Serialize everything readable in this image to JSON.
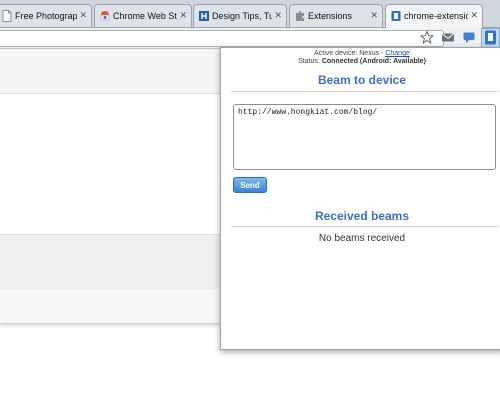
{
  "tabs": [
    {
      "title": "Free Photograph",
      "icon": "page-icon"
    },
    {
      "title": "Chrome Web Sto",
      "icon": "chrome-webstore-icon"
    },
    {
      "title": "Design Tips, Tut",
      "icon": "hongkiat-h-icon"
    },
    {
      "title": "Extensions",
      "icon": "puzzle-icon"
    },
    {
      "title": "chrome-extensio",
      "icon": "extension-page-icon"
    }
  ],
  "toolbar": {
    "icons": [
      "star-icon",
      "gmail-icon",
      "chat-bubble-icon",
      "chrome-to-phone-icon"
    ]
  },
  "popup": {
    "device_label": "Active device: Nexus - ",
    "change_link": "Change",
    "status_label": "Status: ",
    "status_value": "Connected (Android: Available)",
    "beam_heading": "Beam to device",
    "url_value": "http://www.hongkiat.com/blog/",
    "send_label": "Send",
    "received_heading": "Received beams",
    "empty_message": "No beams received"
  },
  "colors": {
    "heading": "#3f6fc0",
    "link": "#1d4fb5",
    "send_button": "#3a87d6"
  }
}
